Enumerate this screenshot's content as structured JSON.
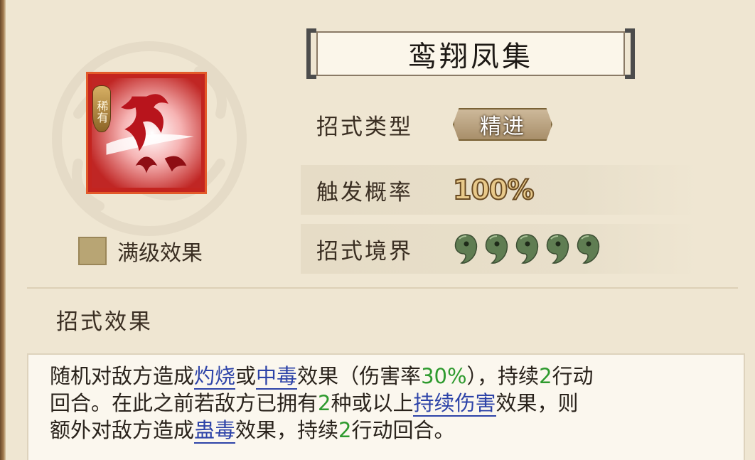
{
  "skill": {
    "name": "鸾翔凤集",
    "rarity": "稀有",
    "max_level_label": "满级效果",
    "type_label": "招式类型",
    "type_value": "精进",
    "trigger_label": "触发概率",
    "trigger_value": "100%",
    "realm_label": "招式境界",
    "realm_level": 5,
    "realm_max": 5
  },
  "effect": {
    "title": "招式效果",
    "line1": {
      "t1": "随机对敌方造成",
      "k1": "灼烧",
      "t2": "或",
      "k2": "中毒",
      "t3": "效果（伤害率",
      "n1": "30%",
      "t4": "），持续",
      "n2": "2",
      "t5": "行动"
    },
    "line2": {
      "t1": "回合。在此之前若敌方已拥有",
      "n1": "2",
      "t2": "种或以上",
      "k1": "持续伤害",
      "t3": "效果，则"
    },
    "line3": {
      "t1": "额外对敌方造成",
      "k1": "蛊毒",
      "t2": "效果，持续",
      "n1": "2",
      "t3": "行动回合。"
    }
  },
  "colors": {
    "background": "#efe6d2",
    "keyword": "#2d43a8",
    "number": "#2e9a2e",
    "icon_frame": "#e35a2a",
    "realm_drop": "#5f7d52"
  },
  "icons": {
    "skill_icon": "phoenix-icon",
    "realm_icon": "jade-drop-icon"
  }
}
